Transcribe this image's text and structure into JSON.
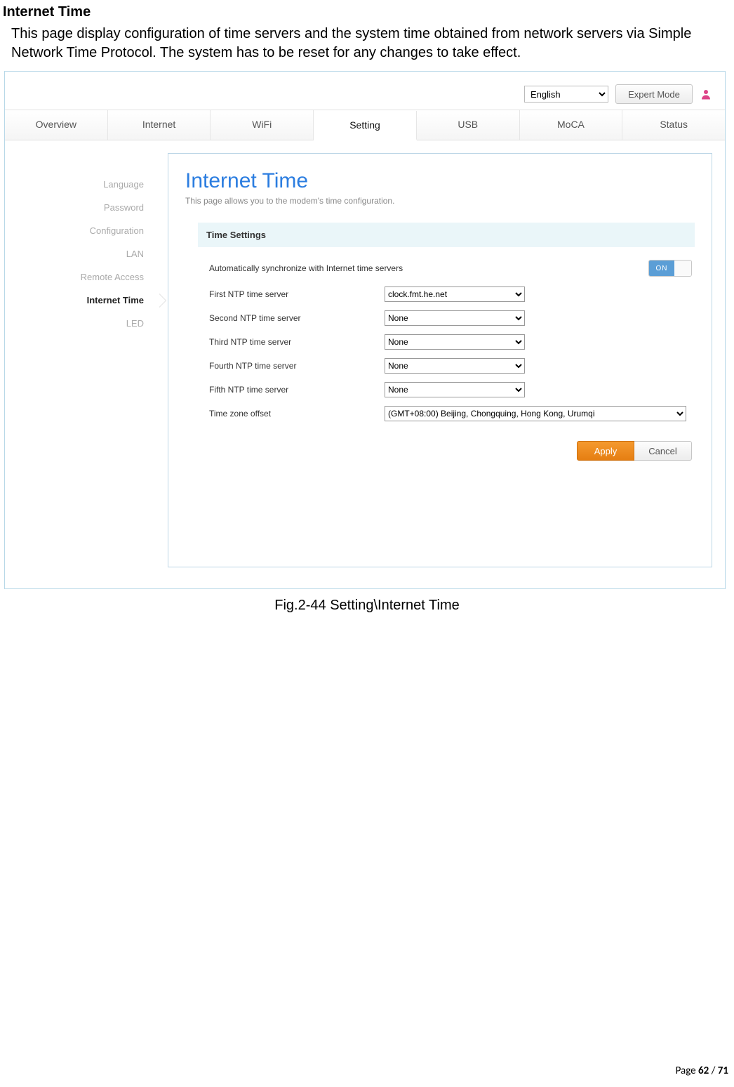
{
  "doc": {
    "heading": "Internet Time",
    "paragraph": "This page display configuration of time servers and the system time obtained from network servers via Simple Network Time Protocol. The system has to be reset for any changes to take effect.",
    "figure_caption": "Fig.2-44 Setting\\Internet Time",
    "footer_prefix": "Page ",
    "footer_page": "62",
    "footer_sep": " / ",
    "footer_total": "71"
  },
  "topbar": {
    "language": "English",
    "expert_button": "Expert Mode"
  },
  "tabs": [
    "Overview",
    "Internet",
    "WiFi",
    "Setting",
    "USB",
    "MoCA",
    "Status"
  ],
  "active_tab_index": 3,
  "sidebar": {
    "items": [
      "Language",
      "Password",
      "Configuration",
      "LAN",
      "Remote Access",
      "Internet Time",
      "LED"
    ],
    "active_index": 5
  },
  "panel": {
    "title": "Internet Time",
    "subtitle": "This page allows you to the modem's time configuration.",
    "section_header": "Time Settings",
    "sync_label": "Automatically synchronize with Internet time servers",
    "toggle_text": "ON",
    "rows": [
      {
        "label": "First NTP time server",
        "value": "clock.fmt.he.net"
      },
      {
        "label": "Second NTP time server",
        "value": "None"
      },
      {
        "label": "Third NTP time server",
        "value": "None"
      },
      {
        "label": "Fourth NTP time server",
        "value": "None"
      },
      {
        "label": "Fifth NTP time server",
        "value": "None"
      }
    ],
    "timezone_label": "Time zone offset",
    "timezone_value": "(GMT+08:00) Beijing, Chongquing, Hong Kong, Urumqi",
    "apply": "Apply",
    "cancel": "Cancel"
  }
}
